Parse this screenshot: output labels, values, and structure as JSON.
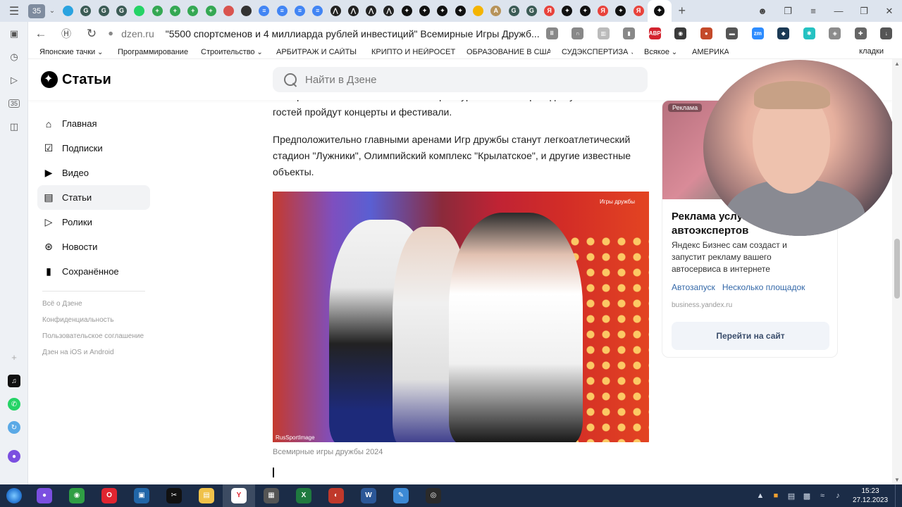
{
  "browser": {
    "tab_counter": "35",
    "tab_icons": [
      {
        "name": "telegram-tab-icon",
        "color": "#2aa3e0",
        "glyph": ""
      },
      {
        "name": "gc-tab-icon",
        "color": "#3b5b55",
        "glyph": "G"
      },
      {
        "name": "gc-tab-icon",
        "color": "#3b5b55",
        "glyph": "G"
      },
      {
        "name": "gc-tab-icon",
        "color": "#3b5b55",
        "glyph": "G"
      },
      {
        "name": "whatsapp-tab-icon",
        "color": "#25d366",
        "glyph": ""
      },
      {
        "name": "plus-green-tab-icon",
        "color": "#34a853",
        "glyph": "+"
      },
      {
        "name": "plus-green-tab-icon",
        "color": "#34a853",
        "glyph": "+"
      },
      {
        "name": "plus-green-tab-icon",
        "color": "#34a853",
        "glyph": "+"
      },
      {
        "name": "plus-green-tab-icon",
        "color": "#34a853",
        "glyph": "+"
      },
      {
        "name": "mail-tab-icon",
        "color": "#d9544f",
        "glyph": ""
      },
      {
        "name": "sphere-tab-icon",
        "color": "#333333",
        "glyph": ""
      },
      {
        "name": "docs-tab-icon",
        "color": "#4285f4",
        "glyph": "≡"
      },
      {
        "name": "docs-tab-icon",
        "color": "#4285f4",
        "glyph": "≡"
      },
      {
        "name": "docs-tab-icon",
        "color": "#4285f4",
        "glyph": "≡"
      },
      {
        "name": "docs-tab-icon",
        "color": "#4285f4",
        "glyph": "≡"
      },
      {
        "name": "chart-tab-icon",
        "color": "#222222",
        "glyph": "⋀"
      },
      {
        "name": "chart-tab-icon",
        "color": "#222222",
        "glyph": "⋀"
      },
      {
        "name": "chart-tab-icon",
        "color": "#222222",
        "glyph": "⋀"
      },
      {
        "name": "chart-tab-icon",
        "color": "#222222",
        "glyph": "⋀"
      },
      {
        "name": "dzen-tab-icon",
        "color": "#111111",
        "glyph": "✦"
      },
      {
        "name": "dzen-tab-icon",
        "color": "#111111",
        "glyph": "✦"
      },
      {
        "name": "dzen-tab-icon",
        "color": "#111111",
        "glyph": "✦"
      },
      {
        "name": "dzen-tab-icon",
        "color": "#111111",
        "glyph": "✦"
      },
      {
        "name": "colored-tab-icon",
        "color": "#f4b400",
        "glyph": ""
      },
      {
        "name": "anthropic-tab-icon",
        "color": "#b7935a",
        "glyph": "A"
      },
      {
        "name": "gc-tab-icon",
        "color": "#3b5b55",
        "glyph": "G"
      },
      {
        "name": "gc-tab-icon",
        "color": "#3b5b55",
        "glyph": "G"
      },
      {
        "name": "yandex-tab-icon",
        "color": "#e8423b",
        "glyph": "Я"
      },
      {
        "name": "dzen-tab-icon",
        "color": "#111111",
        "glyph": "✦"
      },
      {
        "name": "dzen-tab-icon",
        "color": "#111111",
        "glyph": "✦"
      },
      {
        "name": "yandex-tab-icon",
        "color": "#e8423b",
        "glyph": "Я"
      },
      {
        "name": "dzen-tab-icon",
        "color": "#111111",
        "glyph": "✦"
      },
      {
        "name": "yandex-tab-icon",
        "color": "#e8423b",
        "glyph": "Я"
      }
    ],
    "address": {
      "domain": "dzen.ru",
      "title": "\"5500 спортсменов и 4 миллиарда рублей инвестиций\" Всемирные Игры Дружб..."
    },
    "extensions": [
      {
        "name": "apps-grid-icon",
        "color": "#888888",
        "glyph": "⠿"
      },
      {
        "name": "headphones-icon",
        "color": "#888888",
        "glyph": "∩"
      },
      {
        "name": "reader-icon",
        "color": "#bbbbbb",
        "glyph": "▥"
      },
      {
        "name": "bookmark-icon",
        "color": "#888888",
        "glyph": "▮"
      },
      {
        "name": "adblock-plus-icon",
        "color": "#d3242f",
        "glyph": "ABP"
      },
      {
        "name": "tampermonkey-icon",
        "color": "#3a3a3a",
        "glyph": "◉"
      },
      {
        "name": "extension-icon",
        "color": "#c44a2a",
        "glyph": "●"
      },
      {
        "name": "vpn-icon",
        "color": "#555555",
        "glyph": "▬"
      },
      {
        "name": "zoom-icon",
        "color": "#2d8cff",
        "glyph": "zm"
      },
      {
        "name": "extension-dark-icon",
        "color": "#1b3a55",
        "glyph": "◆"
      },
      {
        "name": "extension-cyan-icon",
        "color": "#25c2c2",
        "glyph": "✱"
      },
      {
        "name": "shield-icon",
        "color": "#8c8c8c",
        "glyph": "◈"
      },
      {
        "name": "puzzle-icon",
        "color": "#666666",
        "glyph": "✚"
      },
      {
        "name": "download-icon",
        "color": "#555555",
        "glyph": "↓"
      }
    ],
    "bookmarks": [
      "Японские тачки",
      "Программирование",
      "Строительство",
      "АРБИТРАЖ И САЙТЫ",
      "КРИПТО И НЕЙРОСЕТИ",
      "ОБРАЗОВАНИЕ В США",
      "СУДЭКСПЕРТИЗА",
      "Всякое",
      "АМЕРИКА"
    ],
    "bookmarks_more": "кладки"
  },
  "site": {
    "logo_text": "Статьи",
    "search_placeholder": "Найти в Дзене",
    "nav": [
      {
        "name": "nav-home",
        "icon": "home-icon",
        "label": "Главная"
      },
      {
        "name": "nav-subscriptions",
        "icon": "subscriptions-icon",
        "label": "Подписки"
      },
      {
        "name": "nav-video",
        "icon": "video-icon",
        "label": "Видео"
      },
      {
        "name": "nav-articles",
        "icon": "articles-icon",
        "label": "Статьи"
      },
      {
        "name": "nav-clips",
        "icon": "clips-icon",
        "label": "Ролики"
      },
      {
        "name": "nav-news",
        "icon": "news-icon",
        "label": "Новости"
      },
      {
        "name": "nav-saved",
        "icon": "bookmark-icon",
        "label": "Сохранённое"
      }
    ],
    "active_nav": "Статьи",
    "footer_links": [
      "Всё о Дзене",
      "Конфиденциальность",
      "Пользовательское соглашение",
      "Дзен на iOS и Android"
    ]
  },
  "article": {
    "partial_top": "и спортивных залах Москвы и Екатеринбурга. А по вечерам для участников и гостей пройдут концерты и фестивали.",
    "paragraph": "Предположительно главными аренами Игр дружбы станут легкоатлетический стадион \"Лужники\", Олимпийский комплекс \"Крылатское\", и другие известные объекты.",
    "photo_credit": "RusSportImage",
    "photo_watermark": "Игры дружбы",
    "caption": "Всемирные игры дружбы 2024"
  },
  "ad": {
    "badge": "Реклама",
    "title": "Реклама услуг по автоэкспертов",
    "description": "Яндекс Бизнес сам создаст и запустит рекламу вашего автосервиса в интернете",
    "links": [
      "Автозапуск",
      "Несколько площадок"
    ],
    "domain": "business.yandex.ru",
    "button": "Перейти на сайт"
  },
  "taskbar": {
    "apps": [
      {
        "name": "alice-taskbar-icon",
        "color": "#7b4fe0",
        "glyph": "●"
      },
      {
        "name": "chrome-taskbar-icon",
        "color": "#2f9e44",
        "glyph": "◉"
      },
      {
        "name": "opera-taskbar-icon",
        "color": "#e02530",
        "glyph": "O"
      },
      {
        "name": "monitor-taskbar-icon",
        "color": "#2166a8",
        "glyph": "▣"
      },
      {
        "name": "capcut-taskbar-icon",
        "color": "#111111",
        "glyph": "✂"
      },
      {
        "name": "explorer-taskbar-icon",
        "color": "#f0c24a",
        "glyph": "▤"
      },
      {
        "name": "yandex-browser-taskbar-icon",
        "color": "#ffffff",
        "glyph": "Y"
      },
      {
        "name": "calculator-taskbar-icon",
        "color": "#555555",
        "glyph": "▦"
      },
      {
        "name": "excel-taskbar-icon",
        "color": "#1f7a3f",
        "glyph": "X"
      },
      {
        "name": "video-editor-taskbar-icon",
        "color": "#c0392b",
        "glyph": "◐"
      },
      {
        "name": "word-taskbar-icon",
        "color": "#2b5797",
        "glyph": "W"
      },
      {
        "name": "paint-taskbar-icon",
        "color": "#3c8ad6",
        "glyph": "✎"
      },
      {
        "name": "obs-taskbar-icon",
        "color": "#2a2a2a",
        "glyph": "◎"
      }
    ],
    "time": "15:23",
    "date": "27.12.2023"
  }
}
